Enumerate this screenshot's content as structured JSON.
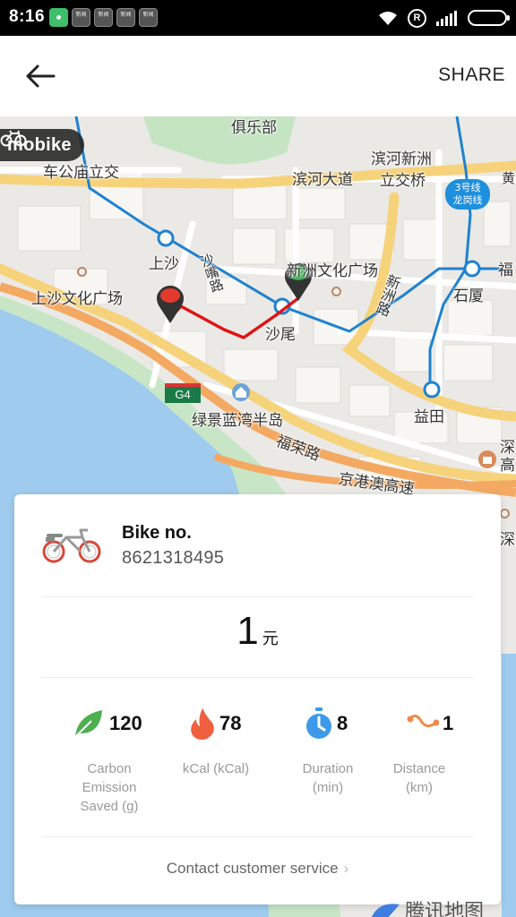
{
  "status_bar": {
    "time": "8:16",
    "news_icon_text": "新闻",
    "reg_icon": "R"
  },
  "header": {
    "share_label": "SHARE"
  },
  "map": {
    "badge_text": "mobike",
    "highway_shield": "G4",
    "metro_line_badge": [
      "3号线",
      "龙岗线"
    ],
    "labels": {
      "club": "俱乐部",
      "chegongmiao": "车公庙立交",
      "binhe_ave": "滨河大道",
      "binhe_xinzhou": "滨河新洲",
      "interchange": "立交桥",
      "shangsha": "上沙",
      "shazui_road": "沙嘴路",
      "xinzhou_plaza": "新洲文化广场",
      "shangsha_plaza": "上沙文化广场",
      "xinzhou_road": "新洲路",
      "shixia": "石厦",
      "shawei": "沙尾",
      "yitian": "益田",
      "lujing_peninsula": "绿景蓝湾半岛",
      "furong_road": "福荣路",
      "expressway": "京港澳高速",
      "edge_fu": "福",
      "edge_shen_high": "深高",
      "edge_shen": "深",
      "edge_huang": "黄"
    },
    "provider_text": "腾讯地图"
  },
  "card": {
    "bike_label": "Bike no.",
    "bike_number": "8621318495",
    "fare_amount": "1",
    "fare_unit": "元",
    "stats": [
      {
        "icon": "leaf-icon",
        "value": "120",
        "label_lines": [
          "Carbon",
          "Emission",
          "Saved (g)"
        ],
        "color": "#4caf50"
      },
      {
        "icon": "flame-icon",
        "value": "78",
        "label_lines": [
          "kCal (kCal)"
        ],
        "color": "#f0603e"
      },
      {
        "icon": "stopwatch-icon",
        "value": "8",
        "label_lines": [
          "Duration",
          "(min)"
        ],
        "color": "#3d9ae8"
      },
      {
        "icon": "route-icon",
        "value": "1",
        "label_lines": [
          "Distance",
          "(km)"
        ],
        "color": "#f08a4b"
      }
    ],
    "contact_label": "Contact customer service"
  },
  "colors": {
    "route": "#e01414",
    "start_pin": "#e23b2e",
    "end_pin": "#2fae48",
    "metro_line": "#1f82d0"
  }
}
